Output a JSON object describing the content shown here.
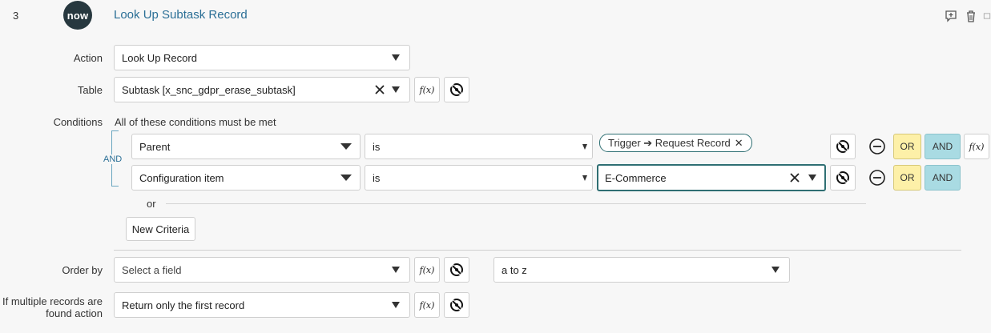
{
  "step": {
    "number": "3",
    "logo_text": "now",
    "title": "Look Up Subtask Record",
    "icons": [
      "add-comment-icon",
      "trash-icon",
      "collapse-icon"
    ]
  },
  "action": {
    "label": "Action",
    "value": "Look Up Record"
  },
  "table": {
    "label": "Table",
    "value": "Subtask [x_snc_gdpr_erase_subtask]"
  },
  "conditions": {
    "label": "Conditions",
    "summary": "All of these conditions must be met",
    "group_operator": "AND",
    "rows": [
      {
        "field": "Parent",
        "operator": "is",
        "value_pill": "Trigger ➔ Request Record",
        "value_text": ""
      },
      {
        "field": "Configuration item",
        "operator": "is",
        "value_pill": "",
        "value_text": "E-Commerce"
      }
    ],
    "or_label": "OR",
    "and_label": "AND",
    "separator_or": "or",
    "new_criteria": "New Criteria"
  },
  "order_by": {
    "label": "Order by",
    "field_placeholder": "Select a field",
    "direction": "a to z"
  },
  "multiple": {
    "label_line1": "If multiple records are",
    "label_line2": "found action",
    "value": "Return only the first record"
  },
  "fx_label": "f(x)",
  "colors": {
    "link": "#2b6f96",
    "or_bg": "#fdf0a8",
    "and_bg": "#a9dbe3",
    "accent": "#2f6f73",
    "logo_bg": "#27383f"
  }
}
